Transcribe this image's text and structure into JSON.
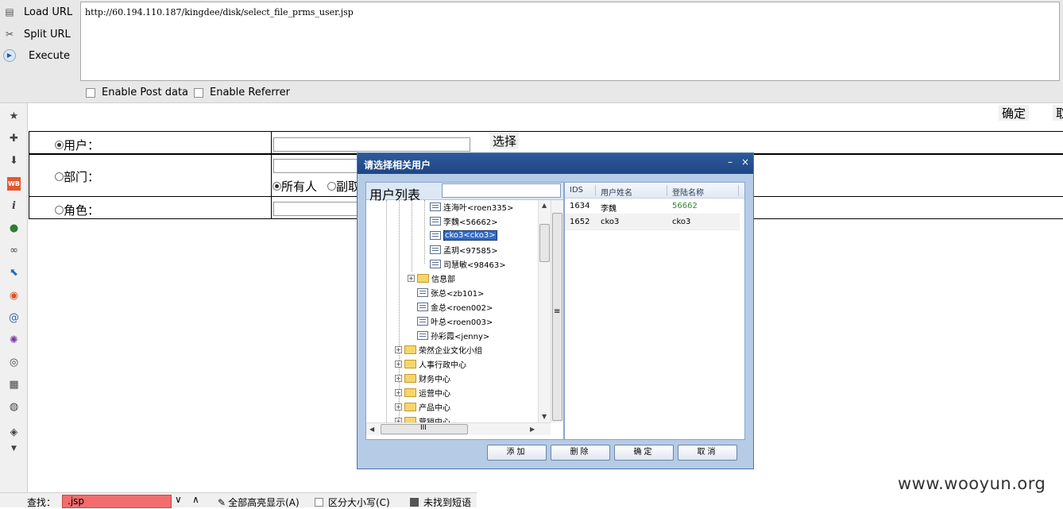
{
  "hackbar": {
    "load_url": "Load URL",
    "split_url": "Split URL",
    "execute": "Execute",
    "url": "http://60.194.110.187/kingdee/disk/select_file_prms_user.jsp",
    "enable_post": "Enable Post data",
    "enable_referrer": "Enable Referrer"
  },
  "sidebar": {
    "icons": [
      "star-icon",
      "puzzle-icon",
      "download-icon",
      "weibo-icon",
      "info-icon",
      "globe-icon",
      "link-icon",
      "pointer-icon",
      "firefox-icon",
      "swirl-icon",
      "virus-icon",
      "palette-icon",
      "layout-icon",
      "world-icon",
      "tag-icon",
      "chevron-down-icon"
    ]
  },
  "page": {
    "confirm": "确定",
    "cancel_partial": "取",
    "user_label": "用户：",
    "dept_label": "部门：",
    "role_label": "角色：",
    "select_button": "选择",
    "all_people": "所有人",
    "deputy_partial": "副取"
  },
  "dialog": {
    "title": "请选择相关用户",
    "minimize": "–",
    "close": "×",
    "user_list_title": "用户列表",
    "tree": [
      {
        "label": "连海叶<roen335>",
        "type": "user"
      },
      {
        "label": "李魏<56662>",
        "type": "user"
      },
      {
        "label": "cko3<cko3>",
        "type": "user",
        "selected": true
      },
      {
        "label": "孟玥<97585>",
        "type": "user"
      },
      {
        "label": "司慧敏<98463>",
        "type": "user"
      },
      {
        "label": "信息部",
        "type": "folder"
      },
      {
        "label": "张总<zb101>",
        "type": "user"
      },
      {
        "label": "金总<roen002>",
        "type": "user"
      },
      {
        "label": "叶总<roen003>",
        "type": "user"
      },
      {
        "label": "孙彩霞<jenny>",
        "type": "user"
      },
      {
        "label": "荣然企业文化小组",
        "type": "folder"
      },
      {
        "label": "人事行政中心",
        "type": "folder"
      },
      {
        "label": "财务中心",
        "type": "folder"
      },
      {
        "label": "运营中心",
        "type": "folder"
      },
      {
        "label": "产品中心",
        "type": "folder"
      },
      {
        "label": "营销中心",
        "type": "folder"
      }
    ],
    "grid_headers": {
      "ids": "IDS",
      "name": "用户姓名",
      "login": "登陆名称"
    },
    "grid_rows": [
      {
        "ids": "1634",
        "name": "李魏",
        "login": "56662"
      },
      {
        "ids": "1652",
        "name": "cko3",
        "login": "cko3"
      }
    ],
    "buttons": {
      "add": "添加",
      "delete": "删除",
      "ok": "确定",
      "cancel": "取消"
    },
    "scroll_grip": "≡",
    "hscroll_grip": "III"
  },
  "findbar": {
    "label": "查找：",
    "query": ".jsp",
    "highlight_all": "全部高亮显示(A)",
    "match_case": "区分大小写(C)",
    "not_found": "未找到短语"
  },
  "watermark": "www.wooyun.org"
}
